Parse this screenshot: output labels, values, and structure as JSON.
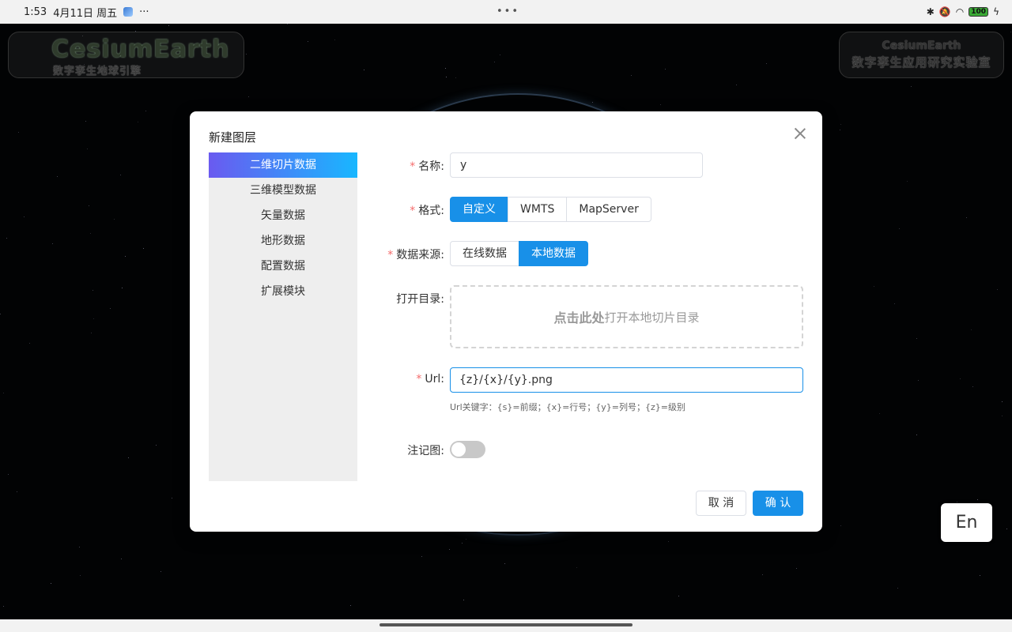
{
  "status_bar": {
    "time": "1:53",
    "date": "4月11日 周五",
    "more": "···",
    "center_dots": "•••",
    "battery": "100"
  },
  "background": {
    "logo_left_title": "CesiumEarth",
    "logo_left_subtitle": "数字孪生地球引擎",
    "logo_right_title": "CesiumEarth",
    "logo_right_subtitle": "数字孪生应用研究实验室"
  },
  "lang_button": "En",
  "dialog": {
    "title": "新建图层",
    "side_nav": [
      {
        "label": "二维切片数据",
        "active": true
      },
      {
        "label": "三维模型数据",
        "active": false
      },
      {
        "label": "矢量数据",
        "active": false
      },
      {
        "label": "地形数据",
        "active": false
      },
      {
        "label": "配置数据",
        "active": false
      },
      {
        "label": "扩展模块",
        "active": false
      }
    ],
    "form": {
      "name_label": "名称:",
      "name_value": "y",
      "format_label": "格式:",
      "format_options": [
        "自定义",
        "WMTS",
        "MapServer"
      ],
      "format_selected": "自定义",
      "source_label": "数据来源:",
      "source_options": [
        "在线数据",
        "本地数据"
      ],
      "source_selected": "本地数据",
      "dir_label": "打开目录:",
      "dropzone_bold": "点击此处",
      "dropzone_text": "打开本地切片目录",
      "url_label": "Url:",
      "url_value": "{z}/{x}/{y}.png",
      "url_hint": "Url关键字：{s}=前缀；{x}=行号；{y}=列号；{z}=级别",
      "annotation_label": "注记图:",
      "annotation_on": false
    },
    "cancel_label": "取 消",
    "confirm_label": "确 认"
  }
}
